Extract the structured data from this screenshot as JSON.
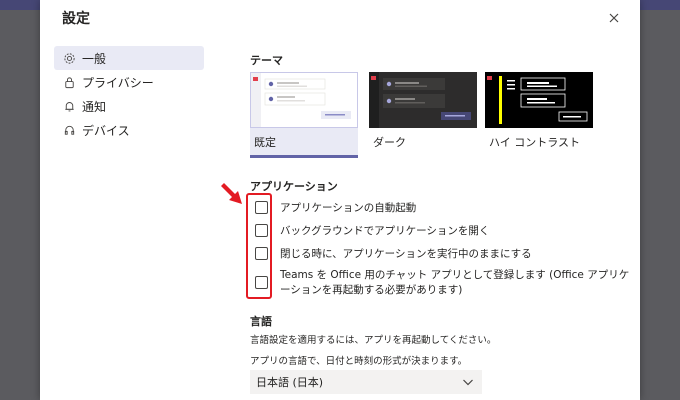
{
  "dialog": {
    "title": "設定"
  },
  "nav": {
    "items": [
      {
        "label": "一般",
        "icon": "gear-icon",
        "selected": true
      },
      {
        "label": "プライバシー",
        "icon": "lock-icon",
        "selected": false
      },
      {
        "label": "通知",
        "icon": "bell-icon",
        "selected": false
      },
      {
        "label": "デバイス",
        "icon": "headset-icon",
        "selected": false
      }
    ]
  },
  "theme": {
    "heading": "テーマ",
    "options": [
      {
        "label": "既定",
        "selected": true
      },
      {
        "label": "ダーク",
        "selected": false
      },
      {
        "label": "ハイ コントラスト",
        "selected": false
      }
    ]
  },
  "application": {
    "heading": "アプリケーション",
    "options": [
      {
        "label": "アプリケーションの自動起動",
        "checked": false
      },
      {
        "label": "バックグラウンドでアプリケーションを開く",
        "checked": false
      },
      {
        "label": "閉じる時に、アプリケーションを実行中のままにする",
        "checked": false
      },
      {
        "label": "Teams を Office 用のチャット アプリとして登録します (Office アプリケーションを再起動する必要があります)",
        "checked": false
      }
    ]
  },
  "language": {
    "heading": "言語",
    "restart_note": "言語設定を適用するには、アプリを再起動してください。",
    "format_note": "アプリの言語で、日付と時刻の形式が決まります。",
    "selected_value": "日本語 (日本)"
  },
  "colors": {
    "accent": "#6264a7",
    "highlight_red": "#e31b23",
    "overlay": "#5b5b5f"
  }
}
